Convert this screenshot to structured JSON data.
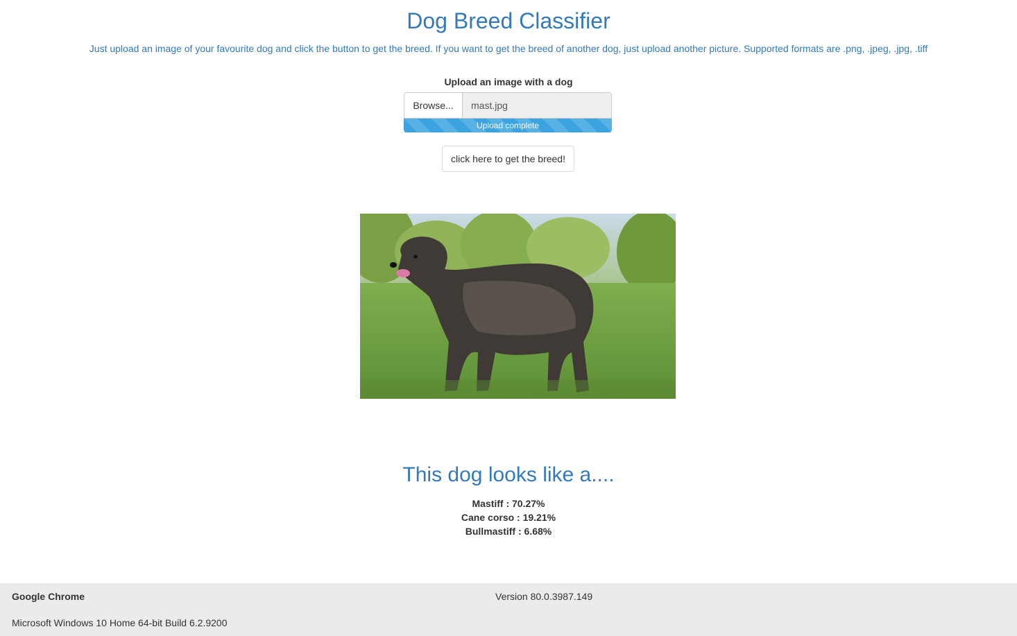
{
  "header": {
    "title": "Dog Breed Classifier",
    "subtitle": "Just upload an image of your favourite dog and click the button to get the breed. If you want to get the breed of another dog, just upload another picture. Supported formats are .png, .jpeg, .jpg, .tiff"
  },
  "upload": {
    "label": "Upload an image with a dog",
    "browse_label": "Browse...",
    "file_name": "mast.jpg",
    "progress_label": "Upload complete",
    "progress_percent": 100
  },
  "action": {
    "button_label": "click here to get the breed!"
  },
  "image": {
    "icon": "dog-photo"
  },
  "results": {
    "heading": "This dog looks like a....",
    "predictions": [
      {
        "text": "Mastiff : 70.27%"
      },
      {
        "text": "Cane corso : 19.21%"
      },
      {
        "text": "Bullmastiff : 6.68%"
      }
    ]
  },
  "footer": {
    "browser": "Google Chrome",
    "version": "Version 80.0.3987.149",
    "os": "Microsoft Windows 10 Home 64-bit Build 6.2.9200"
  },
  "colors": {
    "accent": "#337ab7",
    "progress": "#3aa3e0",
    "footer_bg": "#ebebeb"
  }
}
